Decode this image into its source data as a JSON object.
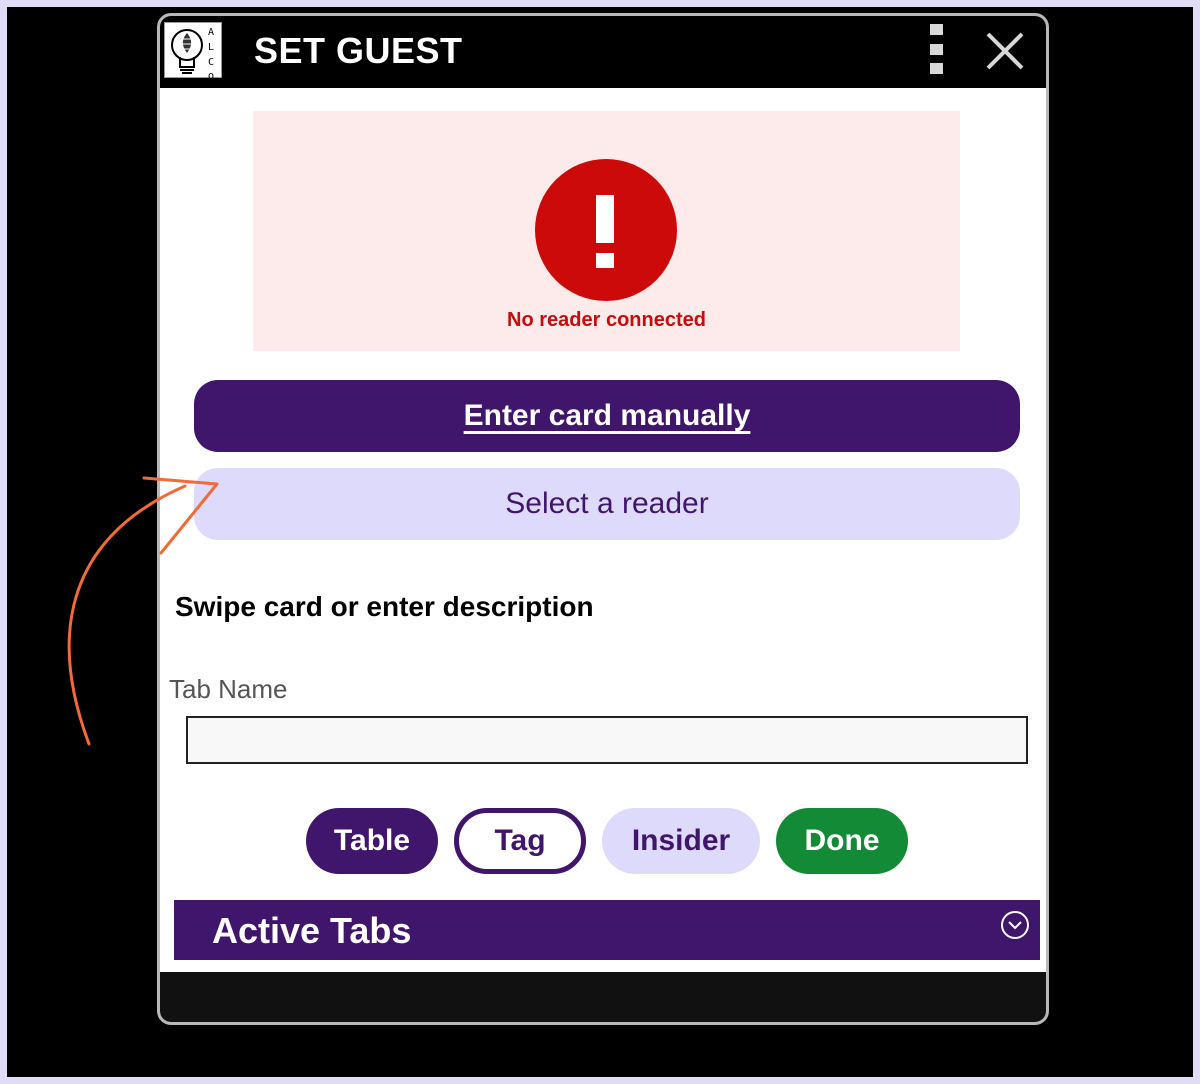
{
  "window": {
    "title": "SET GUEST",
    "logo_text": "ALCO",
    "menu_icon": "kebab-menu-icon",
    "close_icon": "close-icon"
  },
  "alert": {
    "icon": "exclamation-circle-icon",
    "message": "No reader connected",
    "color": "#cc0a0a",
    "background": "#fdeaea"
  },
  "actions": {
    "enter_card_label": "Enter card manually",
    "select_reader_label": "Select a reader"
  },
  "instruction": "Swipe card or enter description",
  "tab_name": {
    "label": "Tab Name",
    "value": "",
    "placeholder": ""
  },
  "chips": [
    {
      "label": "Table"
    },
    {
      "label": "Tag"
    },
    {
      "label": "Insider"
    },
    {
      "label": "Done"
    }
  ],
  "active_tabs": {
    "title": "Active Tabs",
    "toggle_icon": "chevron-down-circle-icon"
  },
  "colors": {
    "primary": "#40156c",
    "secondary": "#dedafc",
    "success": "#128a36",
    "annotation": "#f26a3a"
  }
}
